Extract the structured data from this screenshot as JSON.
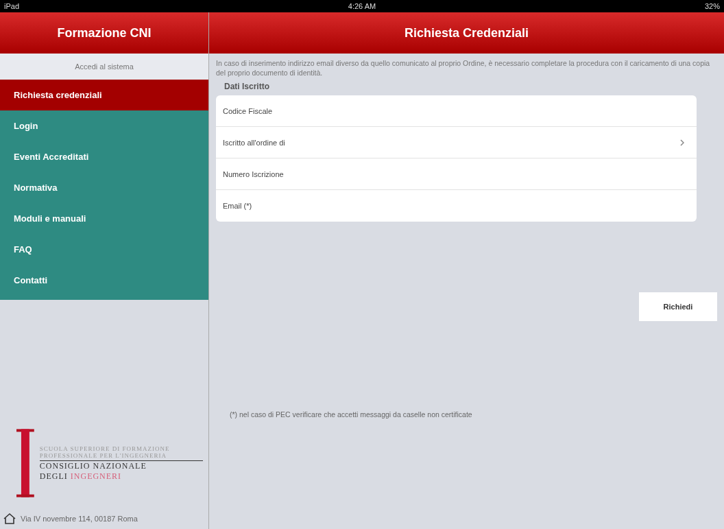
{
  "status_bar": {
    "device": "iPad",
    "time": "4:26 AM",
    "battery": "32%"
  },
  "sidebar": {
    "title": "Formazione CNI",
    "subtitle": "Accedi al sistema",
    "items": [
      {
        "label": "Richiesta credenziali",
        "selected": true
      },
      {
        "label": "Login",
        "selected": false
      },
      {
        "label": "Eventi Accreditati",
        "selected": false
      },
      {
        "label": "Normativa",
        "selected": false
      },
      {
        "label": "Moduli e manuali",
        "selected": false
      },
      {
        "label": "FAQ",
        "selected": false
      },
      {
        "label": "Contatti",
        "selected": false
      }
    ],
    "logo": {
      "line_1": "SCUOLA SUPERIORE DI FORMAZIONE PROFESSIONALE PER L'INGEGNERIA",
      "line_2": "CONSIGLIO NAZIONALE",
      "line_3a": "DEGLI",
      "line_3b": "INGEGNERI"
    },
    "address": "Via IV novembre 114, 00187 Roma"
  },
  "main": {
    "title": "Richiesta Credenziali",
    "intro": "In caso di inserimento indirizzo email diverso da quello comunicato al proprio Ordine, è necessario completare la procedura con il caricamento di una copia del proprio documento di identità.",
    "section": "Dati Iscritto",
    "fields": [
      {
        "placeholder": "Codice Fiscale",
        "kind": "text"
      },
      {
        "placeholder": "Iscritto all'ordine di",
        "kind": "picker"
      },
      {
        "placeholder": "Numero Iscrizione",
        "kind": "text"
      },
      {
        "placeholder": "Email (*)",
        "kind": "text"
      }
    ],
    "button": "Richiedi",
    "footnote": "(*) nel caso di PEC verificare che accetti messaggi da caselle non certificate"
  }
}
